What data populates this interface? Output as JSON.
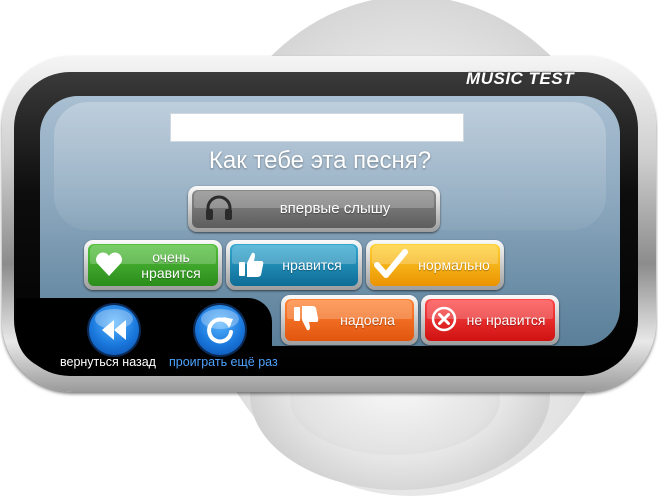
{
  "app": {
    "title": "MUSIC TEST"
  },
  "question": "Как тебе эта песня?",
  "song_field": {
    "value": ""
  },
  "options": {
    "first_time": "впервые слышу",
    "love": "очень нравится",
    "like": "нравится",
    "ok": "нормально",
    "bored": "надоела",
    "dislike": "не нравится"
  },
  "nav": {
    "back_label": "вернуться назад",
    "replay_label": "проиграть ещё раз"
  },
  "colors": {
    "love": "#3aa826",
    "like": "#1a89b5",
    "ok": "#f5b400",
    "bored": "#f06a1e",
    "dislike": "#e12222",
    "link": "#4da3ff"
  },
  "icons": {
    "first_time": "headphones-icon",
    "love": "heart-icon",
    "like": "thumbs-up-icon",
    "ok": "checkmark-icon",
    "bored": "thumbs-down-icon",
    "dislike": "close-circle-icon",
    "back": "rewind-icon",
    "replay": "replay-icon"
  }
}
